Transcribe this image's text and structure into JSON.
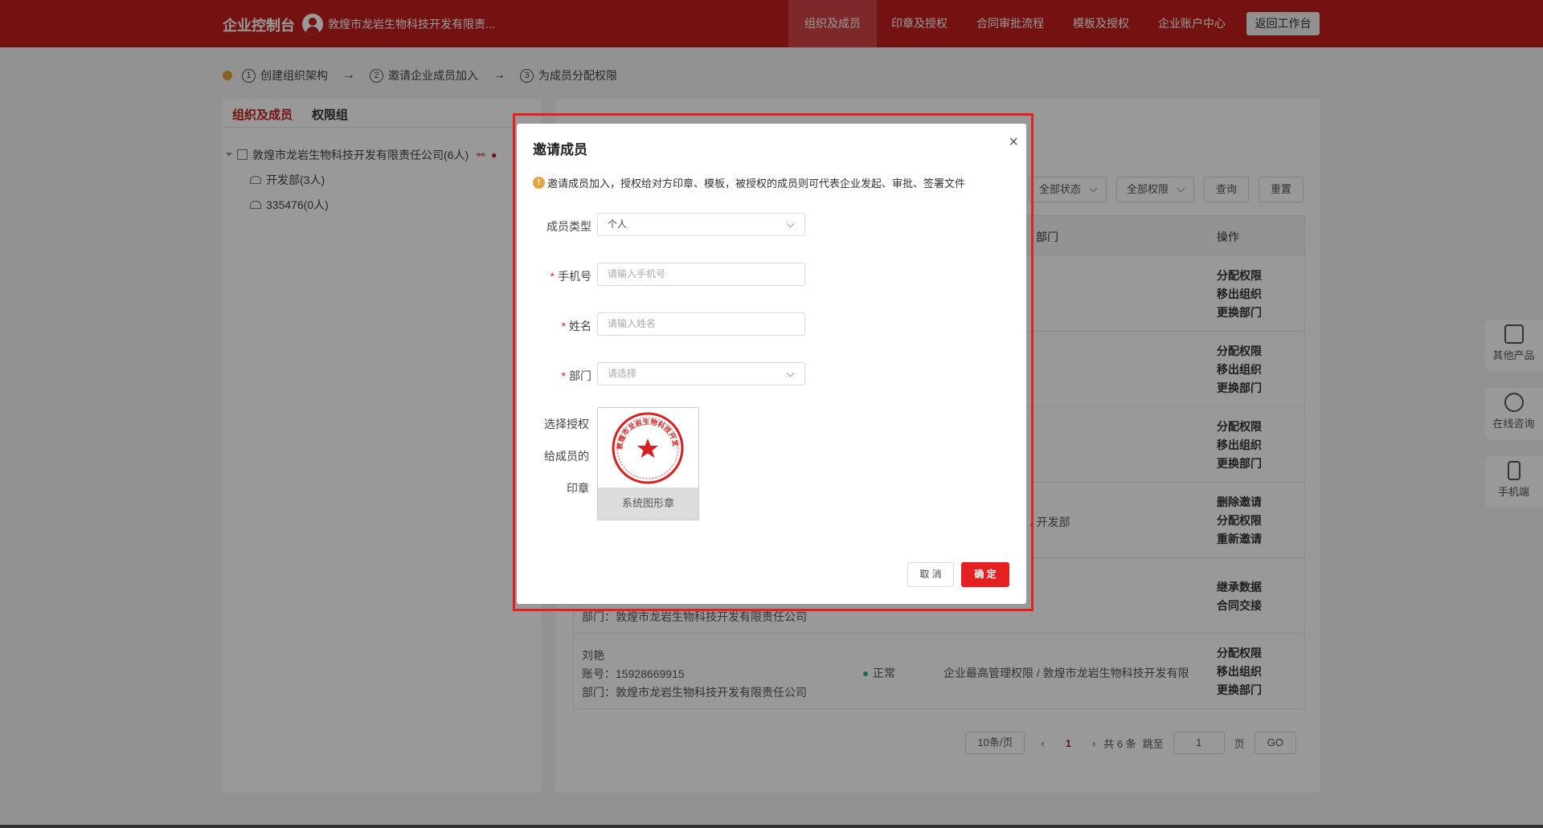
{
  "header": {
    "brand": "企业控制台",
    "company": "敦煌市龙岩生物科技开发有限责...",
    "nav": [
      "组织及成员",
      "印章及授权",
      "合同审批流程",
      "模板及授权",
      "企业账户中心"
    ],
    "back_label": "返回工作台",
    "colors": {
      "primary": "#c11d1d",
      "active": "#d04545"
    }
  },
  "steps": [
    {
      "num": "1",
      "label": "创建组织架构"
    },
    {
      "num": "2",
      "label": "邀请企业成员加入"
    },
    {
      "num": "3",
      "label": "为成员分配权限"
    }
  ],
  "left": {
    "tabs": [
      "组织及成员",
      "权限组"
    ],
    "tree_root": "敦煌市龙岩生物科技开发有限责任公司(6人)",
    "tree_children": [
      "开发部(3人)",
      "335476(0人)"
    ]
  },
  "filters": {
    "status": "全部状态",
    "perm": "全部权限",
    "query": "查询",
    "reset": "重置"
  },
  "table": {
    "headers": {
      "dept": "部门",
      "ops": "操作"
    },
    "rows": [
      {
        "ops": [
          "分配权限",
          "移出组织",
          "更换部门"
        ]
      },
      {
        "ops": [
          "分配权限",
          "移出组织",
          "更换部门"
        ]
      },
      {
        "ops": [
          "分配权限",
          "移出组织",
          "更换部门"
        ]
      },
      {
        "perm": "限 / 开发部",
        "ops": [
          "删除邀请",
          "分配权限",
          "重新邀请"
        ]
      },
      {
        "dept_line": "部门：敦煌市龙岩生物科技开发有限责任公司",
        "ops": [
          "继承数据",
          "合同交接"
        ]
      },
      {
        "name": "刘艳",
        "account": "账号：15928669915",
        "dept_line": "部门：敦煌市龙岩生物科技开发有限责任公司",
        "status": "正常",
        "perm": "企业最高管理权限 / 敦煌市龙岩生物科技开发有限",
        "ops": [
          "分配权限",
          "移出组织",
          "更换部门"
        ]
      }
    ]
  },
  "pager": {
    "size": "10条/页",
    "prev": "‹",
    "current": "1",
    "next": "›",
    "total": "共 6 条",
    "jump": "跳至",
    "input": "1",
    "page": "页",
    "go": "GO"
  },
  "float": [
    "其他产品",
    "在线咨询",
    "手机端"
  ],
  "modal": {
    "title": "邀请成员",
    "tip": "邀请成员加入，授权给对方印章、模板，被授权的成员则可代表企业发起、审批、签署文件",
    "member_type_label": "成员类型",
    "member_type_value": "个人",
    "phone_label": "手机号",
    "phone_placeholder": "请输入手机号",
    "name_label": "姓名",
    "name_placeholder": "请输入姓名",
    "dept_label": "部门",
    "dept_placeholder": "请选择",
    "seal_label": [
      "选择授权",
      "给成员的",
      "印章"
    ],
    "seal_caption": "系统图形章",
    "seal_text": "敦煌市龙岩生物科技开发有限责任公司",
    "cancel": "取 消",
    "ok": "确 定"
  }
}
